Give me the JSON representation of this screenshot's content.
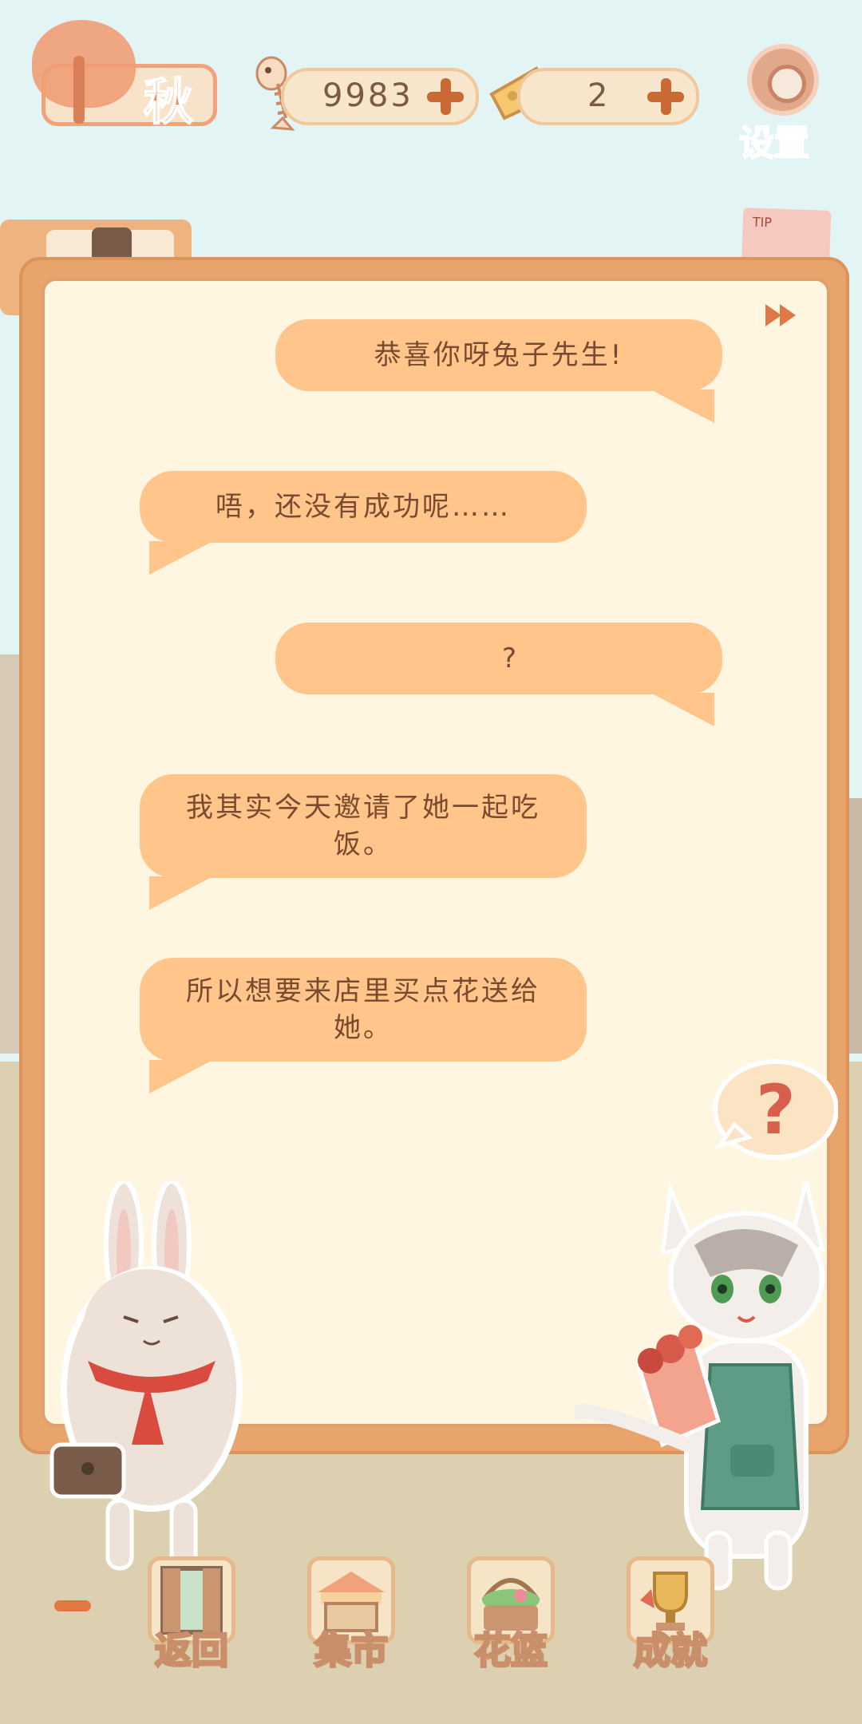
{
  "season": {
    "label": "秋"
  },
  "currency": {
    "fish_bones": {
      "value": "9983",
      "icon": "fishbone-icon"
    },
    "cheese": {
      "value": "2",
      "icon": "cheese-icon"
    }
  },
  "settings": {
    "label": "设置"
  },
  "tip_note": {
    "text": "TIP"
  },
  "dialog": {
    "messages": [
      {
        "side": "right",
        "text": "恭喜你呀兔子先生!"
      },
      {
        "side": "left",
        "text": "唔，还没有成功呢……"
      },
      {
        "side": "right",
        "text": "?"
      },
      {
        "side": "left",
        "text": "我其实今天邀请了她一起吃饭。"
      },
      {
        "side": "left",
        "text": "所以想要来店里买点花送给她。"
      }
    ],
    "skip_icon": "fast-forward-icon"
  },
  "cat_bubble": {
    "text": "?"
  },
  "bottom_nav": [
    {
      "label": "返回",
      "icon": "door-icon"
    },
    {
      "label": "集市",
      "icon": "market-stall-icon"
    },
    {
      "label": "花篮",
      "icon": "flower-basket-icon"
    },
    {
      "label": "成就",
      "icon": "trophy-icon"
    }
  ],
  "colors": {
    "bubble": "#ffc58a",
    "panel": "#e8a46a",
    "paper": "#fff6e2",
    "accent": "#c96a35"
  }
}
